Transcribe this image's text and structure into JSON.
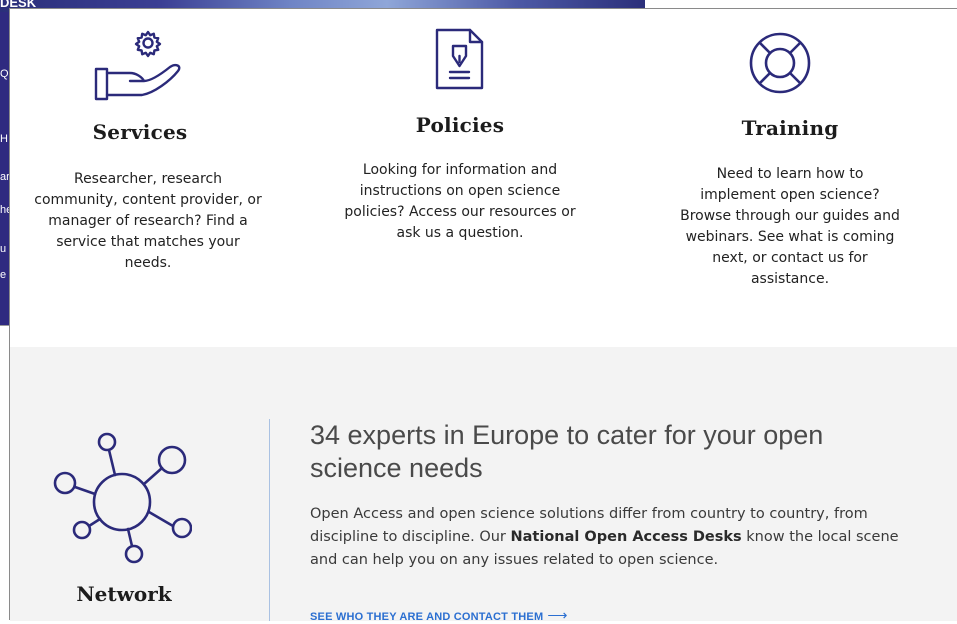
{
  "background": {
    "header_fragment": "DESK",
    "side_fragments": [
      "Q",
      "H",
      "ar",
      "he",
      "u",
      "e"
    ]
  },
  "cards": [
    {
      "id": "services",
      "icon": "hand-gear-icon",
      "title": "Services",
      "description": "Researcher, research community, content provider, or manager of research? Find a service that matches your needs."
    },
    {
      "id": "policies",
      "icon": "document-pen-icon",
      "title": "Policies",
      "description": "Looking for information and instructions on open science policies? Access our resources or ask us a question."
    },
    {
      "id": "training",
      "icon": "lifebuoy-icon",
      "title": "Training",
      "description": "Need to learn how to implement open science? Browse through our guides and webinars. See what is coming next, or contact us for assistance."
    }
  ],
  "network": {
    "icon": "network-hub-icon",
    "title": "Network",
    "heading": "34 experts in Europe to cater for your open science needs",
    "text_before": "Open Access and open science solutions differ from country to country, from discipline to discipline. Our ",
    "text_bold": "National Open Access Desks",
    "text_after": " know the local scene and can help you on any issues related to open science.",
    "link_label": "SEE WHO THEY ARE AND CONTACT THEM",
    "link_arrow": "⟶"
  },
  "colors": {
    "icon_navy": "#2b2a7a",
    "link_blue": "#2b6fd1",
    "bottom_bg": "#f3f3f3",
    "divider": "#a9c1e2"
  }
}
